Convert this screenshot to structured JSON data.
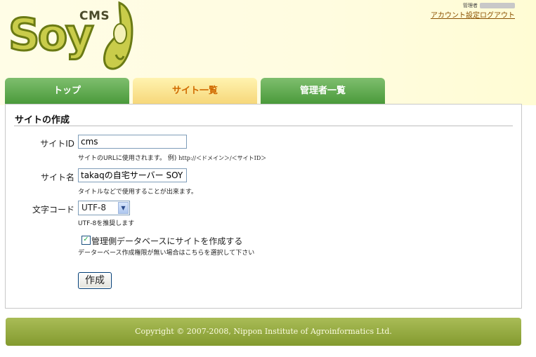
{
  "logo": {
    "cms": "CMS",
    "word": "Soy"
  },
  "admin": {
    "label": "管理者",
    "account_link": "アカウント設定",
    "logout_link": "ログアウト"
  },
  "tabs": [
    {
      "label": "トップ"
    },
    {
      "label": "サイト一覧"
    },
    {
      "label": "管理者一覧"
    }
  ],
  "form": {
    "title": "サイトの作成",
    "site_id": {
      "label": "サイトID",
      "value": "cms",
      "hint_prefix": "サイトのURLに使用されます。 例)",
      "hint_example": "http://＜ドメイン＞/＜サイトID＞"
    },
    "site_name": {
      "label": "サイト名",
      "value": "takaqの自宅サーバー SOY",
      "hint": "タイトルなどで使用することが出来ます。"
    },
    "charset": {
      "label": "文字コード",
      "value": "UTF-8",
      "hint": "UTF-8を推奨します"
    },
    "admin_db": {
      "checked": true,
      "label": "管理側データベースにサイトを作成する",
      "hint": "データーベース作成権限が無い場合はこちらを選択して下さい"
    },
    "submit_label": "作成"
  },
  "footer": {
    "copyright": "Copyright © 2007-2008, Nippon Institute of Agroinformatics Ltd."
  }
}
